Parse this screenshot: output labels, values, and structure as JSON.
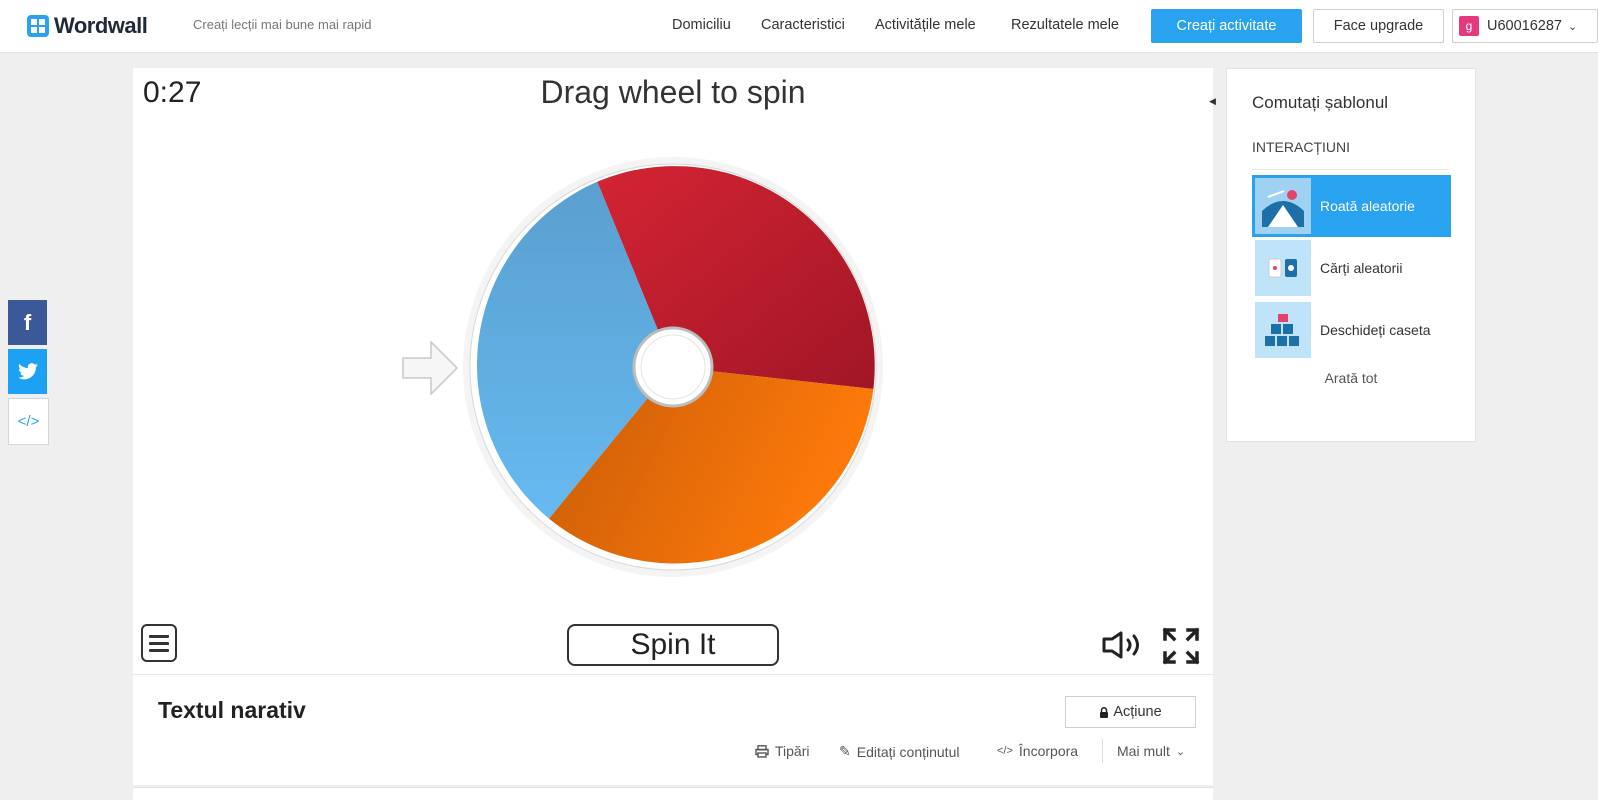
{
  "header": {
    "logo_text": "Wordwall",
    "tagline": "Creați lecții mai bune mai rapid",
    "nav": [
      "Domiciliu",
      "Caracteristici",
      "Activitățile mele",
      "Rezultatele mele"
    ],
    "create_label": "Creați activitate",
    "upgrade_label": "Face upgrade",
    "user_initial": "g",
    "user_name": "U60016287",
    "accent_color": "#29a3ef"
  },
  "share": {
    "facebook_icon": "f",
    "embed_icon": "</>"
  },
  "game": {
    "timer": "0:27",
    "title": "Drag wheel to spin",
    "spin_label": "Spin It",
    "wheel_segments": [
      {
        "color": "#c8202f",
        "label": ""
      },
      {
        "color": "#f07a10",
        "label": ""
      },
      {
        "color": "#5eb0e5",
        "label": ""
      }
    ]
  },
  "activity": {
    "title": "Textul narativ",
    "action_label": "Acțiune",
    "print_label": "Tipări",
    "edit_label": "Editați conținutul",
    "embed_label": "Încorpora",
    "more_label": "Mai mult"
  },
  "sidebar": {
    "title": "Comutați șablonul",
    "section": "INTERACȚIUNI",
    "templates": [
      {
        "label": "Roată aleatorie",
        "icon": "wheel-template-icon",
        "active": true
      },
      {
        "label": "Cărți aleatorii",
        "icon": "cards-template-icon",
        "active": false
      },
      {
        "label": "Deschideți caseta",
        "icon": "boxes-template-icon",
        "active": false
      }
    ],
    "show_all": "Arată tot"
  }
}
